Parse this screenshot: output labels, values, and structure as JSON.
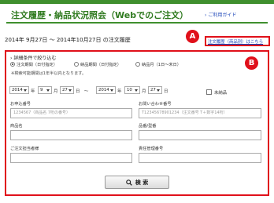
{
  "header": {
    "title": "注文履歴・納品状況照会（Webでのご注文）",
    "guide_link": "ご利用ガイド"
  },
  "period": {
    "text": "2014年 9月27日 〜 2014年10月27日 の注文履歴"
  },
  "markers": {
    "a": "A",
    "b": "B"
  },
  "product_link": {
    "label": "注文履歴（商品別）はこちら"
  },
  "search": {
    "heading": "詳細条件で絞り込む",
    "radio_options": [
      {
        "label": "注文期間（日付指定）",
        "checked": true
      },
      {
        "label": "納品期間（日付指定）",
        "checked": false
      },
      {
        "label": "納品月（1日〜末日）",
        "checked": false
      }
    ],
    "note": "※検索可能期間は1年半以内となります。",
    "date_range": {
      "from_year": "2014",
      "from_month": "9",
      "from_day": "27",
      "to_year": "2014",
      "to_month": "10",
      "to_day": "27",
      "year_unit": "年",
      "month_unit": "月",
      "day_unit": "日",
      "separator": "〜"
    },
    "undelivered_label": "未納品",
    "fields": {
      "order_no": {
        "label": "お申込番号",
        "placeholder": "1234567（商品名 7桁の番号）"
      },
      "inquiry_no": {
        "label": "お問い合わせ番号",
        "placeholder": "T12345678901234（注文番号 T＋数字14桁）"
      },
      "product_name": {
        "label": "商品名",
        "placeholder": ""
      },
      "item_model": {
        "label": "品番/型番",
        "placeholder": ""
      },
      "orderer": {
        "label": "ご注文担当者様",
        "placeholder": ""
      },
      "asset_no": {
        "label": "責任管理番号",
        "placeholder": ""
      }
    },
    "search_button": "検 索"
  },
  "colors": {
    "brand_green": "#3f8f2e",
    "marker_red": "#e0101a",
    "link_blue": "#1a44b8"
  }
}
